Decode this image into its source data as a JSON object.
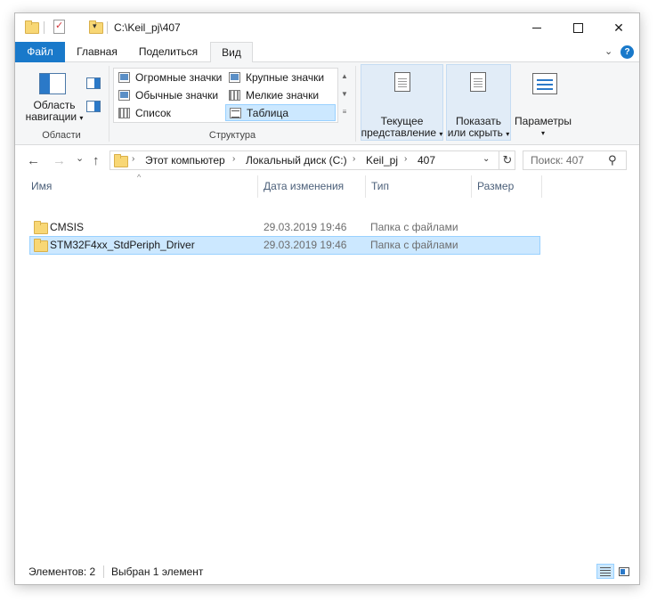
{
  "window": {
    "title": "C:\\Keil_pj\\407",
    "close_glyph": "✕"
  },
  "quick_access": {
    "dropdown_glyph": "▾"
  },
  "ribbon_tabs": [
    "Файл",
    "Главная",
    "Поделиться",
    "Вид"
  ],
  "ribbon_right": {
    "collapse_glyph": "⌄",
    "help_glyph": "?"
  },
  "ribbon": {
    "panes_group": {
      "nav_pane_label_line1": "Область",
      "nav_pane_label_line2": "навигации",
      "label": "Области"
    },
    "layout_group": {
      "items": [
        "Огромные значки",
        "Крупные значки",
        "Обычные значки",
        "Мелкие значки",
        "Список",
        "Таблица"
      ],
      "selected": "Таблица",
      "label": "Структура"
    },
    "current_view": {
      "line1": "Текущее",
      "line2": "представление"
    },
    "show_hide": {
      "line1": "Показать",
      "line2": "или скрыть"
    },
    "options": {
      "label": "Параметры"
    },
    "caret": "▾"
  },
  "nav": {
    "back": "←",
    "forward": "→",
    "recent": "⌄",
    "up": "↑",
    "breadcrumbs": [
      "Этот компьютер",
      "Локальный диск (C:)",
      "Keil_pj",
      "407"
    ],
    "crumb_sep": "›",
    "refresh": "↻",
    "dropdown": "⌄"
  },
  "search": {
    "placeholder": "Поиск: 407",
    "icon": "⚲"
  },
  "columns": {
    "name": "Имя",
    "date": "Дата изменения",
    "type": "Тип",
    "size": "Размер",
    "sort_glyph": "^"
  },
  "files": [
    {
      "name": "CMSIS",
      "date": "29.03.2019 19:46",
      "type": "Папка с файлами",
      "size": "",
      "selected": false
    },
    {
      "name": "STM32F4xx_StdPeriph_Driver",
      "date": "29.03.2019 19:46",
      "type": "Папка с файлами",
      "size": "",
      "selected": true
    }
  ],
  "status": {
    "count": "Элементов: 2",
    "selection": "Выбран 1 элемент"
  },
  "colors": {
    "accent": "#1979ca",
    "selection_bg": "#cce8ff",
    "selection_border": "#99d1ff",
    "folder": "#f8d775"
  }
}
